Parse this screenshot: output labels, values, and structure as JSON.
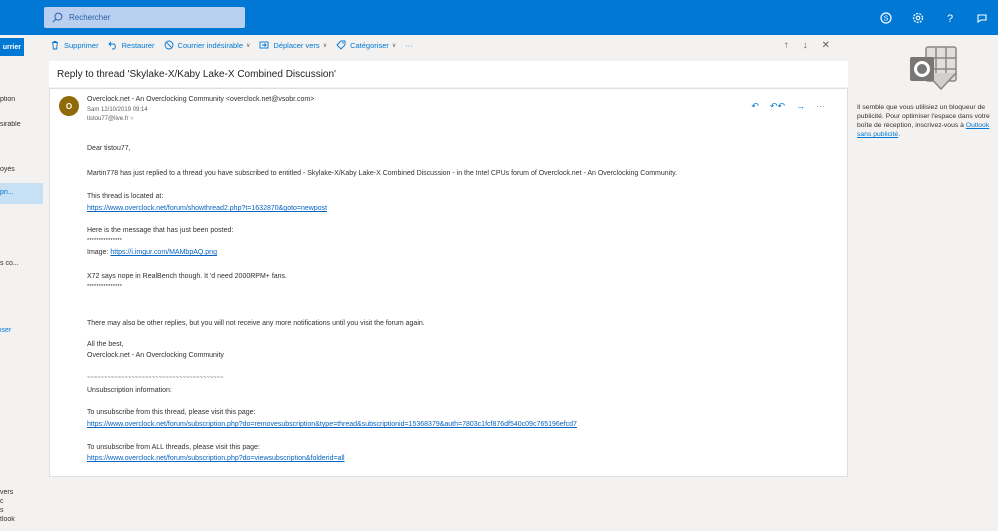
{
  "search": {
    "placeholder": "Rechercher"
  },
  "left_nav": {
    "new_mail": "urrier",
    "items": [
      "ption",
      "sirable",
      "oyés",
      "pri...",
      "s co...",
      "iser"
    ],
    "footer": [
      "vers",
      "c",
      "s",
      "tlook"
    ]
  },
  "commands": {
    "delete": "Supprimer",
    "restore": "Restaurer",
    "junk": "Courrier indésirable",
    "move": "Déplacer vers",
    "categorize": "Catégoriser",
    "more": "···"
  },
  "message": {
    "subject": "Reply to thread 'Skylake-X/Kaby Lake-X Combined Discussion'",
    "avatar_initial": "O",
    "from": "Overclock.net - An Overclocking Community <overclock.net@vsobr.com>",
    "date": "Sam 12/10/2019 09:14",
    "to": "tistou77@live.fr",
    "greeting": "Dear tistou77,",
    "intro": "Martin778 has just replied to a thread you have subscribed to entitled - Skylake-X/Kaby Lake-X Combined Discussion - in the Intel CPUs forum of Overclock.net - An Overclocking Community.",
    "located_label": "This thread is located at:",
    "thread_link": "https://www.overclock.net/forum/showthread2.php?t=1632870&goto=newpost",
    "posted_label": "Here is the message that has just been posted:",
    "stars1": "***************",
    "image_prefix": "Image: ",
    "image_link": "https://i.imgur.com/MAMbpAQ.png",
    "quote": "X72 says nope in RealBench though. It 'd need 2000RPM+ fans.",
    "stars2": "***************",
    "more_replies": "There may also be other replies, but you will not receive any more notifications until you visit the forum again.",
    "best": "All the best,",
    "signature": "Overclock.net - An Overclocking Community",
    "tildes": "~~~~~~~~~~~~~~~~~~~~~~~~~~~~~~~~~~~~~~~~",
    "unsub_info": "Unsubscription information:",
    "unsub_thread_label": "To unsubscribe from this thread, please visit this page:",
    "unsub_thread_link": "https://www.overclock.net/forum/subscription.php?do=removesubscription&type=thread&subscriptionid=15368379&auth=7803c1fcf876df540c09c765196efcd7",
    "unsub_all_label": "To unsubscribe from ALL threads, please visit this page:",
    "unsub_all_link": "https://www.overclock.net/forum/subscription.php?do=viewsubscription&folderid=all"
  },
  "ad": {
    "text": "Il semble que vous utilisiez un bloqueur de publicité. Pour optimiser l'espace dans votre boîte de réception, inscrivez-vous à",
    "link": "Outlook sans publicité",
    "tail": "."
  },
  "colors": {
    "accent": "#0078d4",
    "avatar": "#8f6a09"
  }
}
